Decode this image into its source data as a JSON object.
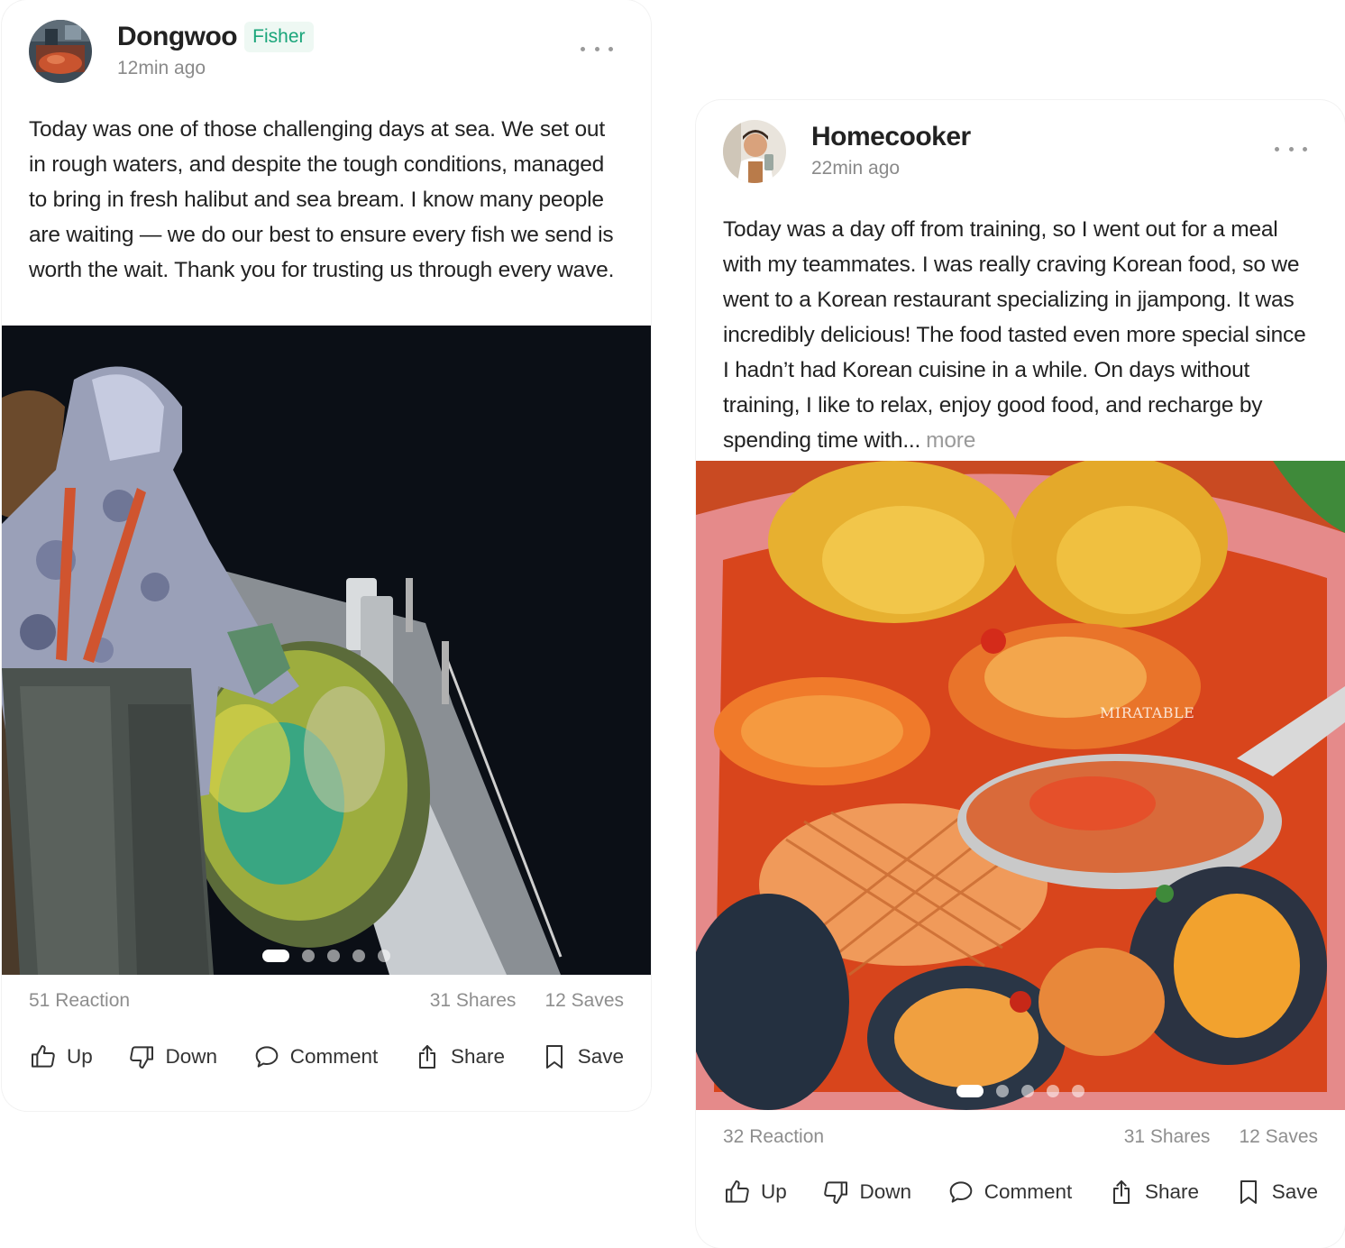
{
  "posts": [
    {
      "author": "Dongwoo",
      "badge": "Fisher",
      "time": "12min ago",
      "text": "Today was one of those challenging days at sea. We set out in rough waters, and despite the tough conditions, managed to bring in fresh halibut and sea bream. I know many people are waiting — we do our best to ensure every fish we send is worth the wait. Thank you for trusting us through every wave.",
      "more_label": "",
      "reactions": "51 Reaction",
      "shares": "31 Shares",
      "saves": "12 Saves",
      "carousel": {
        "count": 5,
        "active_index": 0
      },
      "actions": {
        "up": "Up",
        "down": "Down",
        "comment": "Comment",
        "share": "Share",
        "save": "Save"
      }
    },
    {
      "author": "Homecooker",
      "badge": "",
      "time": "22min ago",
      "text": "Today was a day off from training, so I went out for a meal with my teammates. I was really craving Korean food, so we went to a Korean restaurant specializing in jjampong. It was incredibly delicious! The food tasted even more special since I hadn’t had Korean cuisine in a while. On days without training, I like to relax, enjoy good food, and recharge by spending time with...",
      "more_label": "more",
      "watermark": "MIRATABLE",
      "reactions": "32 Reaction",
      "shares": "31 Shares",
      "saves": "12 Saves",
      "carousel": {
        "count": 5,
        "active_index": 0
      },
      "actions": {
        "up": "Up",
        "down": "Down",
        "comment": "Comment",
        "share": "Share",
        "save": "Save"
      }
    }
  ],
  "colors": {
    "badge_text": "#1aa57a",
    "badge_bg": "#eef8f3",
    "muted": "#8e8e8e"
  },
  "icons": [
    "more-dots-icon",
    "thumbs-up-icon",
    "thumbs-down-icon",
    "comment-icon",
    "share-icon",
    "bookmark-icon"
  ]
}
